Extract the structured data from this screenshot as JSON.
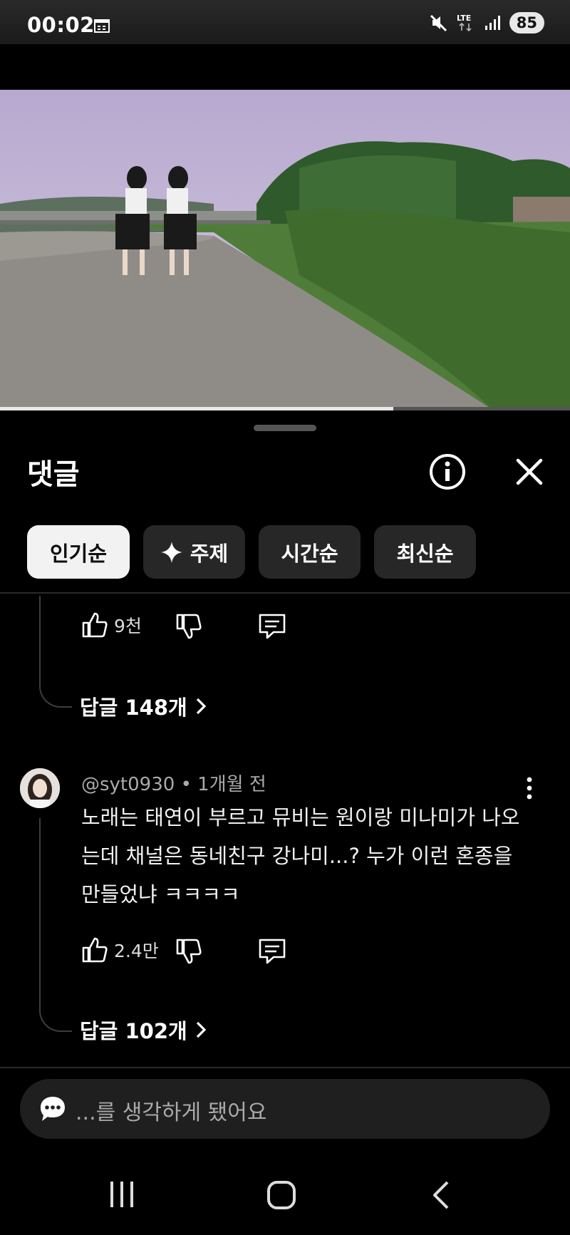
{
  "status_bar": {
    "time": "00:02",
    "battery": "85",
    "network": "LTE"
  },
  "video": {
    "progress": 0.69
  },
  "comments_sheet": {
    "title": "댓글",
    "sort_chips": [
      {
        "label": "인기순",
        "active": true
      },
      {
        "label": "주제",
        "active": false,
        "icon": "sparkle-icon"
      },
      {
        "label": "시간순",
        "active": false
      },
      {
        "label": "최신순",
        "active": false
      }
    ]
  },
  "comments": [
    {
      "likes": "9천",
      "replies_label": "답글 148개"
    },
    {
      "author": "@syt0930",
      "time": "1개월 전",
      "text": "노래는 태연이 부르고 뮤비는 원이랑 미나미가 나오는데 채널은 동네친구 강나미...? 누가 이런 혼종을 만들었냐 ㅋㅋㅋㅋ",
      "likes": "2.4만",
      "replies_label": "답글 102개"
    }
  ],
  "comment_input": {
    "placeholder": "...를 생각하게 됐어요"
  },
  "colors": {
    "background": "#000000",
    "chip_active": "#f2f2f2",
    "chip_inactive": "#272727"
  }
}
